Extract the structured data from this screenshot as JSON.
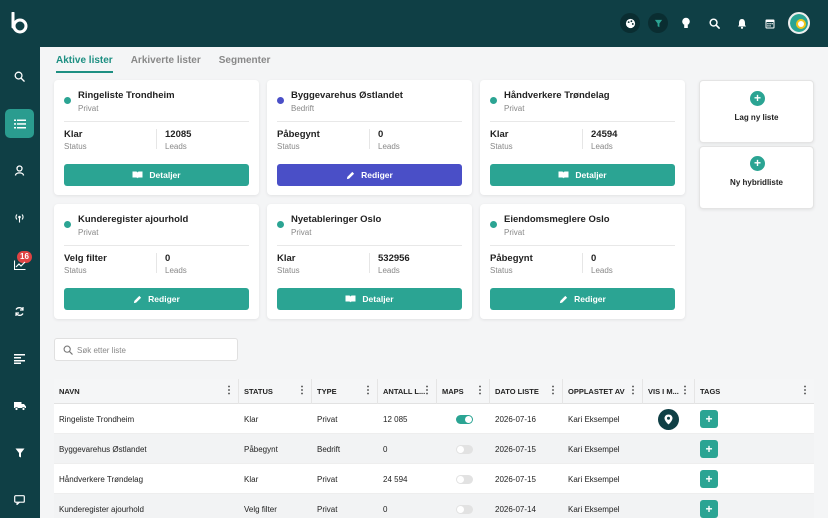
{
  "tabs": [
    {
      "label": "Aktive lister"
    },
    {
      "label": "Arkiverte lister"
    },
    {
      "label": "Segmenter"
    }
  ],
  "sidebar": {
    "badge": "16"
  },
  "cards": [
    {
      "title": "Ringeliste Trondheim",
      "type": "Privat",
      "status": "Klar",
      "status_label": "Status",
      "leads": "12085",
      "leads_label": "Leads",
      "button": "Detaljer",
      "dot_color": "#2ba493"
    },
    {
      "title": "Byggevarehus Østlandet",
      "type": "Bedrift",
      "status": "Påbegynt",
      "status_label": "Status",
      "leads": "0",
      "leads_label": "Leads",
      "button": "Rediger",
      "dot_color": "#4a4fc7"
    },
    {
      "title": "Håndverkere Trøndelag",
      "type": "Privat",
      "status": "Klar",
      "status_label": "Status",
      "leads": "24594",
      "leads_label": "Leads",
      "button": "Detaljer",
      "dot_color": "#2ba493"
    },
    {
      "title": "Kunderegister ajourhold",
      "type": "Privat",
      "status": "Velg filter",
      "status_label": "Status",
      "leads": "0",
      "leads_label": "Leads",
      "button": "Rediger",
      "dot_color": "#2ba493"
    },
    {
      "title": "Nyetableringer Oslo",
      "type": "Privat",
      "status": "Klar",
      "status_label": "Status",
      "leads": "532956",
      "leads_label": "Leads",
      "button": "Detaljer",
      "dot_color": "#2ba493"
    },
    {
      "title": "Eiendomsmeglere Oslo",
      "type": "Privat",
      "status": "Påbegynt",
      "status_label": "Status",
      "leads": "0",
      "leads_label": "Leads",
      "button": "Rediger",
      "dot_color": "#2ba493"
    }
  ],
  "new_list": {
    "label": "Lag ny liste"
  },
  "new_hybrid": {
    "label": "Ny hybridliste"
  },
  "search": {
    "placeholder": "Søk etter liste"
  },
  "table": {
    "headers": [
      "NAVN",
      "STATUS",
      "TYPE",
      "ANTALL L...",
      "MAPS",
      "DATO LISTE",
      "OPPLASTET AV",
      "VIS I M...",
      "TAGS"
    ],
    "rows": [
      {
        "name": "Ringeliste Trondheim",
        "status": "Klar",
        "type": "Privat",
        "count": "12 085",
        "maps": true,
        "date": "2026-07-16",
        "uploader": "Kari Eksempel",
        "show_map": true
      },
      {
        "name": "Byggevarehus Østlandet",
        "status": "Påbegynt",
        "type": "Bedrift",
        "count": "0",
        "maps": false,
        "date": "2026-07-15",
        "uploader": "Kari Eksempel",
        "show_map": false
      },
      {
        "name": "Håndverkere Trøndelag",
        "status": "Klar",
        "type": "Privat",
        "count": "24 594",
        "maps": false,
        "date": "2026-07-15",
        "uploader": "Kari Eksempel",
        "show_map": false
      },
      {
        "name": "Kunderegister ajourhold",
        "status": "Velg filter",
        "type": "Privat",
        "count": "0",
        "maps": false,
        "date": "2026-07-14",
        "uploader": "Kari Eksempel",
        "show_map": false
      }
    ]
  },
  "colors": {
    "accent": "#2ba493",
    "brand_dark": "#0f3f45",
    "edit_blue": "#4a4fc7",
    "badge_red": "#e04343"
  }
}
